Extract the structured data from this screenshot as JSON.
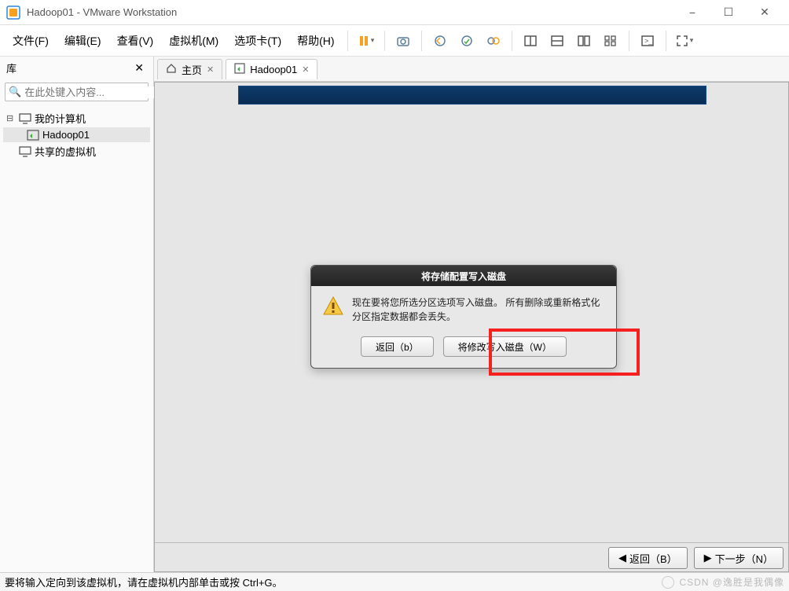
{
  "titlebar": {
    "title": "Hadoop01 - VMware Workstation"
  },
  "menubar": {
    "file": "文件(F)",
    "edit": "编辑(E)",
    "view": "查看(V)",
    "vm": "虚拟机(M)",
    "tabs": "选项卡(T)",
    "help": "帮助(H)"
  },
  "sidebar": {
    "title": "库",
    "search_placeholder": "在此处键入内容...",
    "tree": {
      "my_computer": "我的计算机",
      "hadoop01": "Hadoop01",
      "shared": "共享的虚拟机"
    }
  },
  "tabs": {
    "home": "主页",
    "vm": "Hadoop01"
  },
  "dialog": {
    "title": "将存储配置写入磁盘",
    "message": "现在要将您所选分区选项写入磁盘。 所有删除或重新格式化分区指定数据都会丢失。",
    "back": "返回（b）",
    "write": "将修改写入磁盘（W）"
  },
  "nav": {
    "back": "返回（B）",
    "next": "下一步（N）"
  },
  "statusbar": {
    "hint": "要将输入定向到该虚拟机，请在虚拟机内部单击或按 Ctrl+G。",
    "watermark": "CSDN @逸胜是我偶像"
  }
}
